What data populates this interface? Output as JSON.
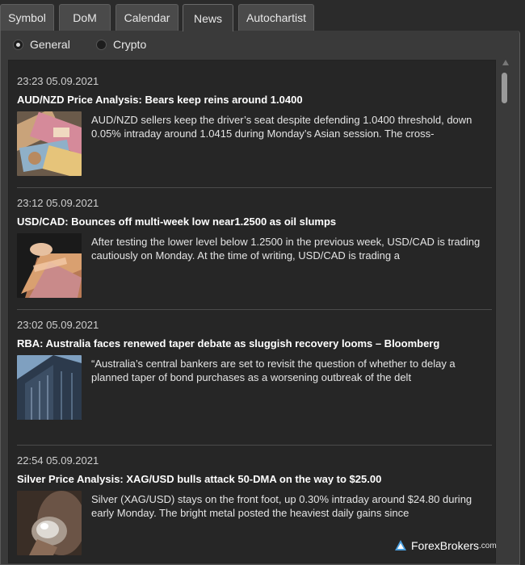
{
  "tabs": [
    {
      "label": "Symbol"
    },
    {
      "label": "DoM"
    },
    {
      "label": "Calendar"
    },
    {
      "label": "News",
      "active": true
    },
    {
      "label": "Autochartist"
    }
  ],
  "filters": [
    {
      "label": "General",
      "selected": true
    },
    {
      "label": "Crypto",
      "selected": false
    }
  ],
  "news": [
    {
      "timestamp": "23:23 05.09.2021",
      "title": "AUD/NZD Price Analysis: Bears keep reins around 1.0400",
      "summary": "AUD/NZD sellers keep the driver’s seat despite defending 1.0400 threshold, down 0.05% intraday around 1.0415 during Monday’s Asian session. The cross-",
      "thumb_icon": "banknotes-image"
    },
    {
      "timestamp": "23:12 05.09.2021",
      "title": "USD/CAD: Bounces off multi-week low near1.2500 as oil slumps",
      "summary": "After testing the lower level below 1.2500 in the previous week, USD/CAD is trading cautiously on Monday. At the time of writing, USD/CAD is trading a",
      "thumb_icon": "cash-fan-image"
    },
    {
      "timestamp": "23:02 05.09.2021",
      "title": "RBA: Australia faces renewed taper debate as sluggish recovery looms – Bloomberg",
      "summary": "“Australia’s central bankers are set to revisit the question of whether to delay a planned taper of bond purchases as a worsening outbreak of the delt",
      "thumb_icon": "bank-building-image"
    },
    {
      "timestamp": "22:54 05.09.2021",
      "title": "Silver Price Analysis: XAG/USD bulls attack 50-DMA on the way to $25.00",
      "summary": "Silver (XAG/USD) stays on the front foot, up 0.30% intraday around $24.80 during early Monday. The bright metal posted the heaviest daily gains since",
      "thumb_icon": "silver-nugget-image"
    }
  ],
  "watermark": {
    "brand": "ForexBrokers",
    "suffix": ".com"
  }
}
